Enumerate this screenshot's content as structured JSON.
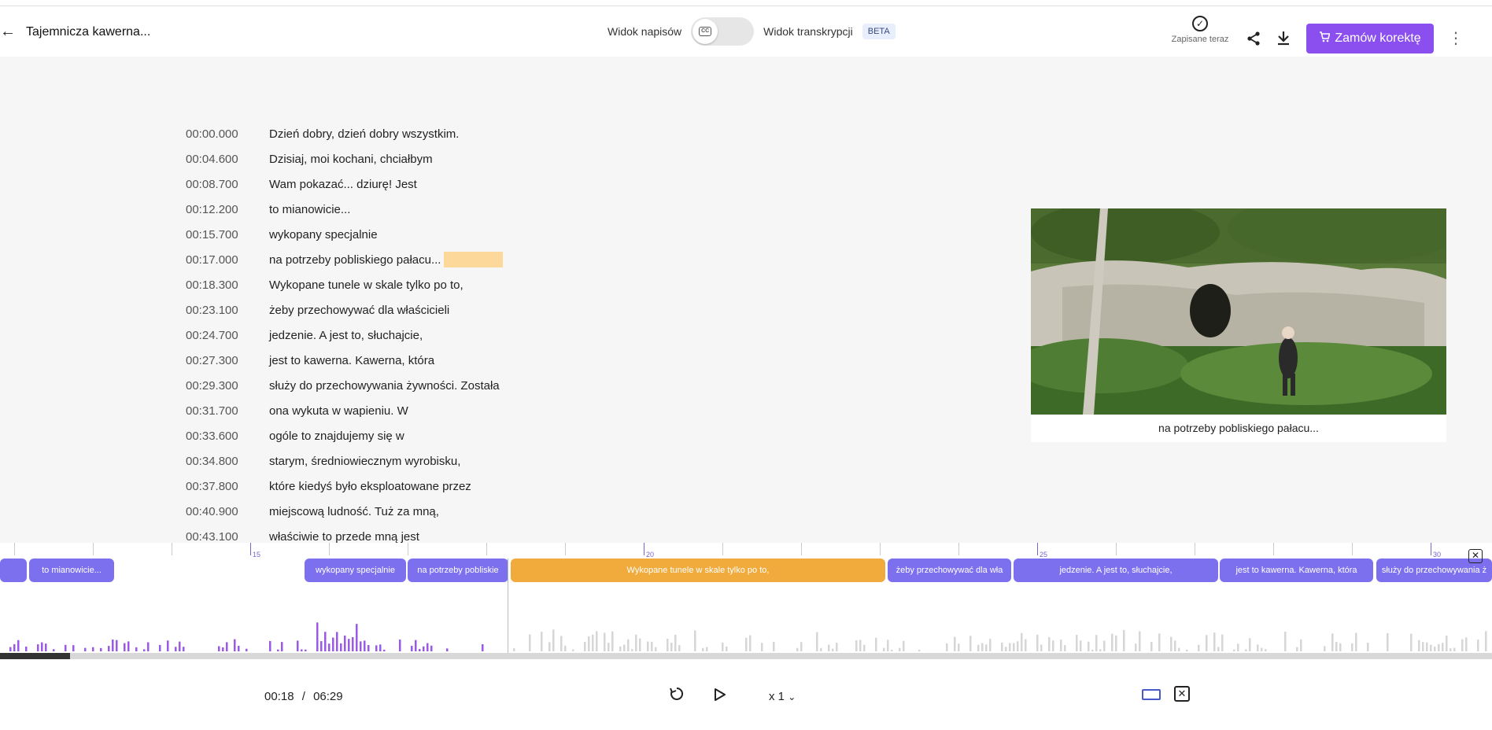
{
  "header": {
    "title": "Tajemnicza kawerna...",
    "subtitle_view_label": "Widok napisów",
    "cc_label": "CC",
    "transcription_view_label": "Widok transkrypcji",
    "beta_badge": "BETA",
    "saved_label": "Zapisane teraz",
    "order_button_label": "Zamów korektę",
    "colors": {
      "accent": "#8b4ff0"
    }
  },
  "transcript": [
    {
      "time": "00:00.000",
      "text": "Dzień dobry, dzień dobry wszystkim."
    },
    {
      "time": "00:04.600",
      "text": "Dzisiaj, moi kochani, chciałbym"
    },
    {
      "time": "00:08.700",
      "text": "Wam pokazać... dziurę! Jest"
    },
    {
      "time": "00:12.200",
      "text": "to mianowicie..."
    },
    {
      "time": "00:15.700",
      "text": "wykopany specjalnie"
    },
    {
      "time": "00:17.000",
      "text": "na potrzeby pobliskiego pałacu...",
      "highlight": true
    },
    {
      "time": "00:18.300",
      "text": "Wykopane tunele w skale tylko po to,"
    },
    {
      "time": "00:23.100",
      "text": "żeby przechowywać dla właścicieli"
    },
    {
      "time": "00:24.700",
      "text": "jedzenie. A  jest to, słuchajcie,"
    },
    {
      "time": "00:27.300",
      "text": "jest to kawerna. Kawerna, która"
    },
    {
      "time": "00:29.300",
      "text": "służy do przechowywania żywności. Została"
    },
    {
      "time": "00:31.700",
      "text": "ona wykuta w wapieniu. W"
    },
    {
      "time": "00:33.600",
      "text": "ogóle to znajdujemy się w"
    },
    {
      "time": "00:34.800",
      "text": "starym, średniowiecznym wyrobisku,"
    },
    {
      "time": "00:37.800",
      "text": "które kiedyś było eksploatowane przez"
    },
    {
      "time": "00:40.900",
      "text": "miejscową ludność. Tuż za mną,"
    },
    {
      "time": "00:43.100",
      "text": "właściwie to przede mną jest"
    }
  ],
  "video": {
    "caption": "na potrzeby pobliskiego pałacu..."
  },
  "timeline": {
    "tick_labels": [
      "15",
      "20",
      "25",
      "30"
    ],
    "segments": [
      {
        "text": ""
      },
      {
        "text": "to mianowicie..."
      },
      {
        "text": "wykopany specjalnie"
      },
      {
        "text": "na potrzeby pobliskie"
      },
      {
        "text": "Wykopane tunele w skale tylko po to,",
        "active": true
      },
      {
        "text": "żeby przechowywać dla wła"
      },
      {
        "text": "jedzenie. A jest to, słuchajcie,"
      },
      {
        "text": "jest to kawerna. Kawerna, która"
      },
      {
        "text": "służy do przechowywania ż"
      }
    ],
    "progress_fraction": 0.0467
  },
  "player": {
    "current_time": "00:18",
    "separator": "/",
    "duration": "06:29",
    "speed": "x 1"
  }
}
